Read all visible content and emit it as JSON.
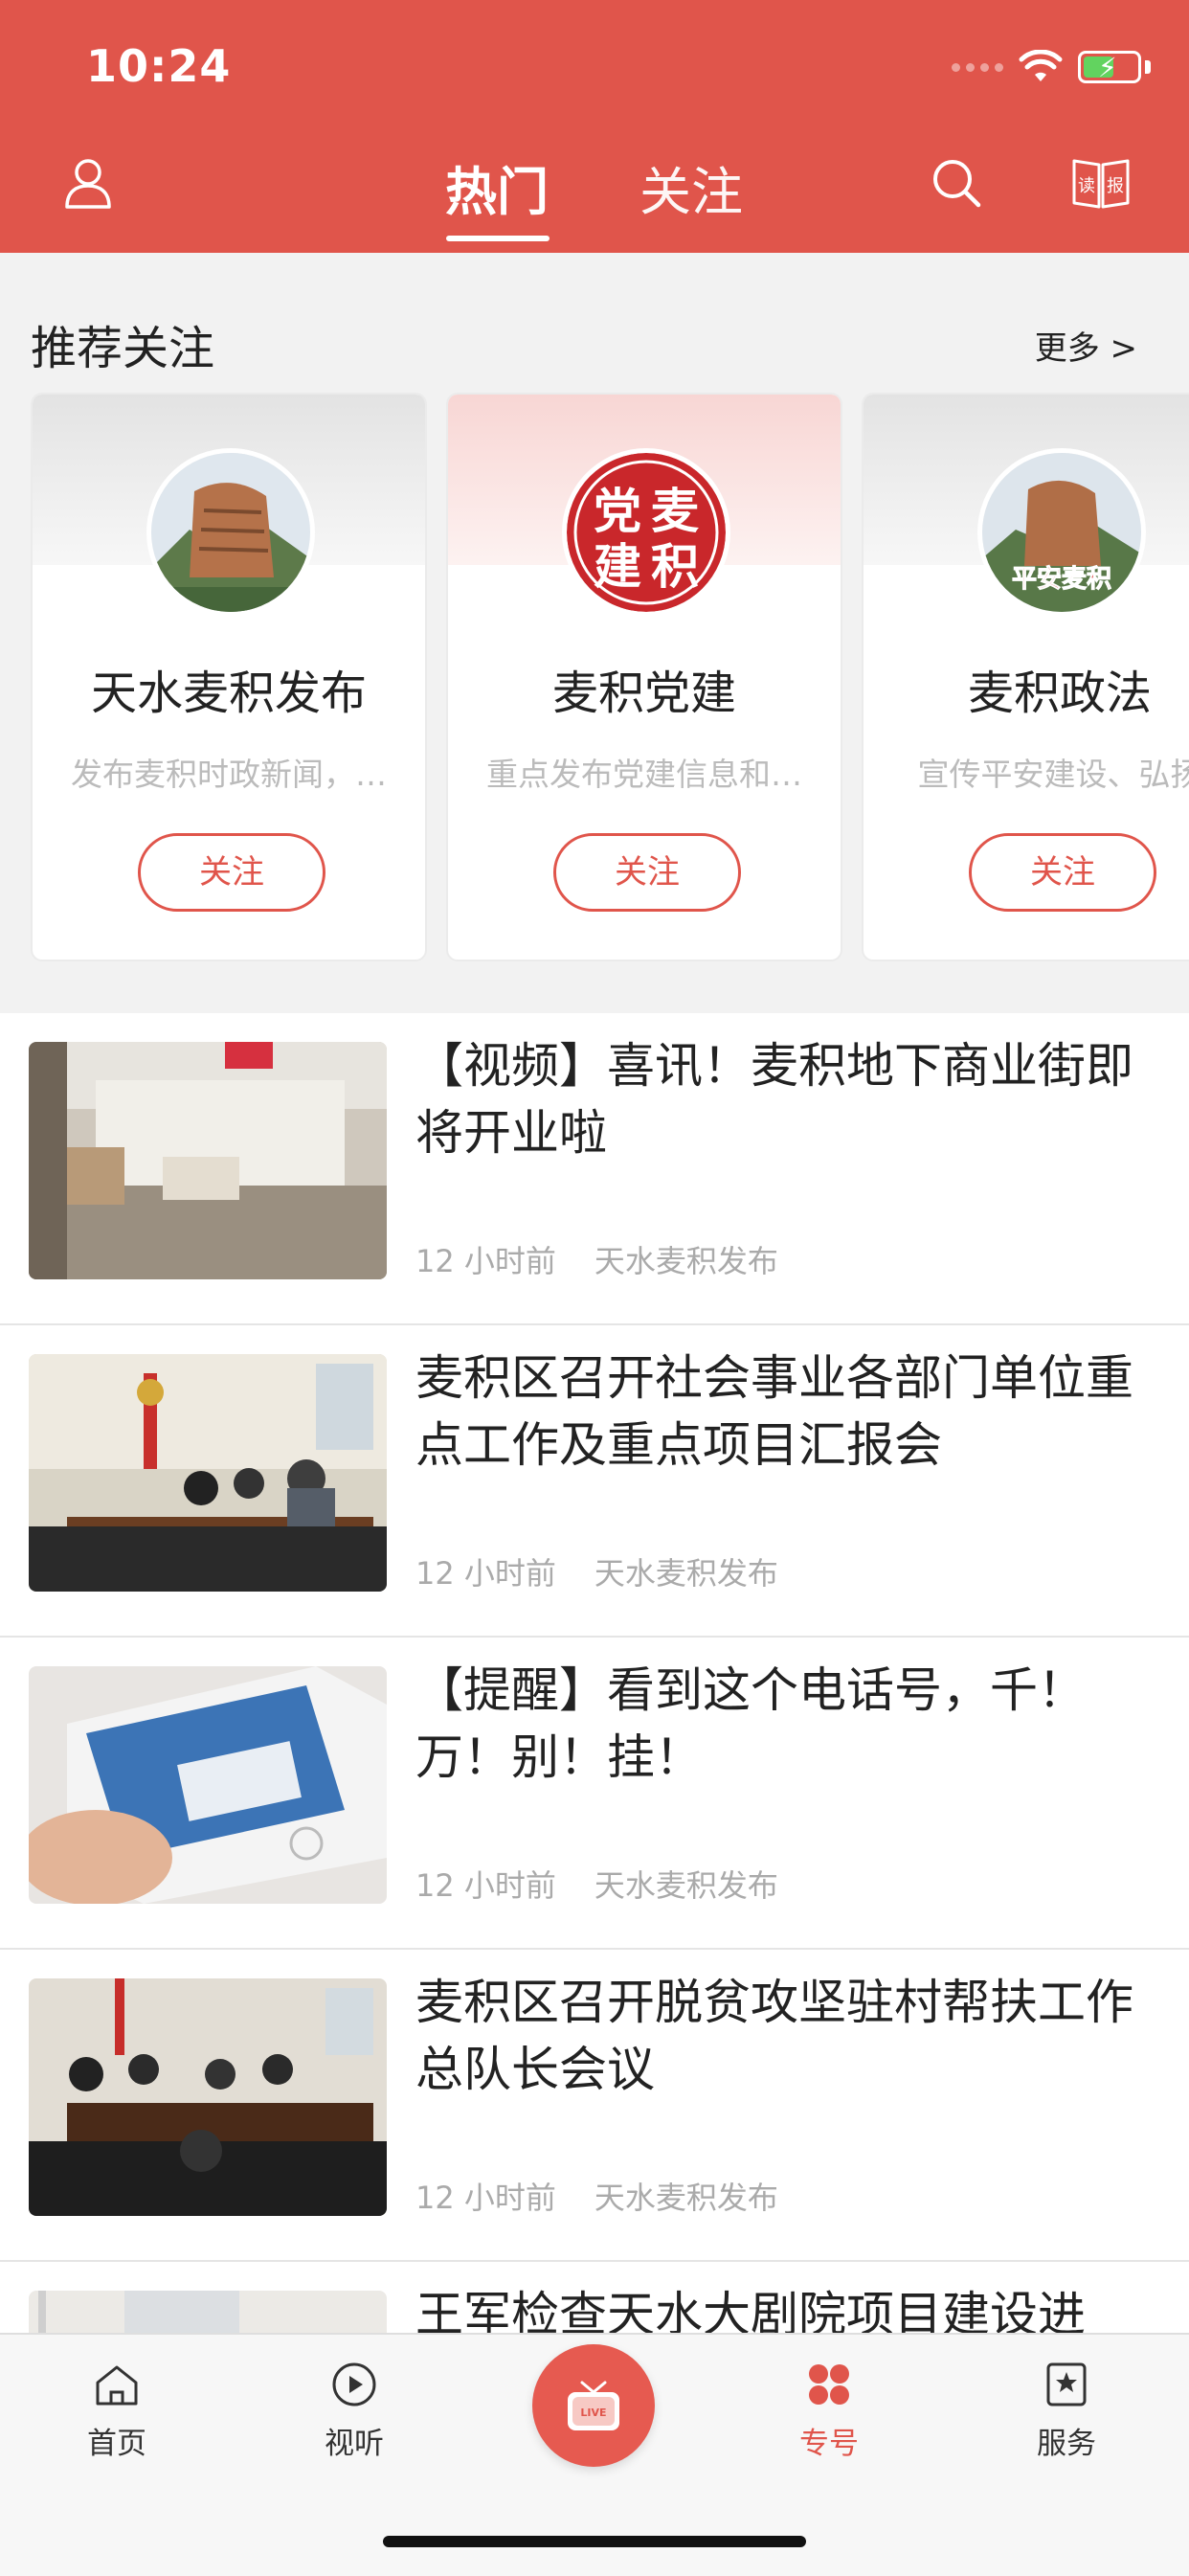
{
  "status_bar": {
    "time": "10:24"
  },
  "header": {
    "tabs": [
      {
        "label": "热门"
      },
      {
        "label": "关注"
      }
    ],
    "book_icon_text": "读报"
  },
  "recommend": {
    "title": "推荐关注",
    "more": "更多 >",
    "cards": [
      {
        "name": "天水麦积发布",
        "desc": "发布麦积时政新闻，…",
        "button": "关注"
      },
      {
        "name": "麦积党建",
        "desc": "重点发布党建信息和…",
        "button": "关注",
        "logo_text": "党麦建积"
      },
      {
        "name": "麦积政法",
        "desc": "宣传平安建设、弘扬",
        "button": "关注",
        "logo_text": "平安麦积"
      }
    ]
  },
  "news": [
    {
      "title": "【视频】喜讯！麦积地下商业街即将开业啦",
      "time": "12 小时前",
      "source": "天水麦积发布"
    },
    {
      "title": "麦积区召开社会事业各部门单位重点工作及重点项目汇报会",
      "time": "12 小时前",
      "source": "天水麦积发布"
    },
    {
      "title": "【提醒】看到这个电话号，千！万！别！挂！",
      "time": "12 小时前",
      "source": "天水麦积发布"
    },
    {
      "title": "麦积区召开脱贫攻坚驻村帮扶工作总队长会议",
      "time": "12 小时前",
      "source": "天水麦积发布"
    },
    {
      "title": "王军检查天水大剧院项目建设进"
    }
  ],
  "tabbar": {
    "items": [
      {
        "label": "首页",
        "icon": "home-icon"
      },
      {
        "label": "视听",
        "icon": "play-icon"
      },
      {
        "label": "",
        "icon": "live-tv-icon",
        "badge": "LIVE"
      },
      {
        "label": "专号",
        "icon": "grid-icon"
      },
      {
        "label": "服务",
        "icon": "star-tab-icon"
      }
    ],
    "active": 3
  },
  "colors": {
    "brand": "#e0554b",
    "meta_text": "#aaaaaa",
    "desc_text": "#bbbbbb"
  }
}
